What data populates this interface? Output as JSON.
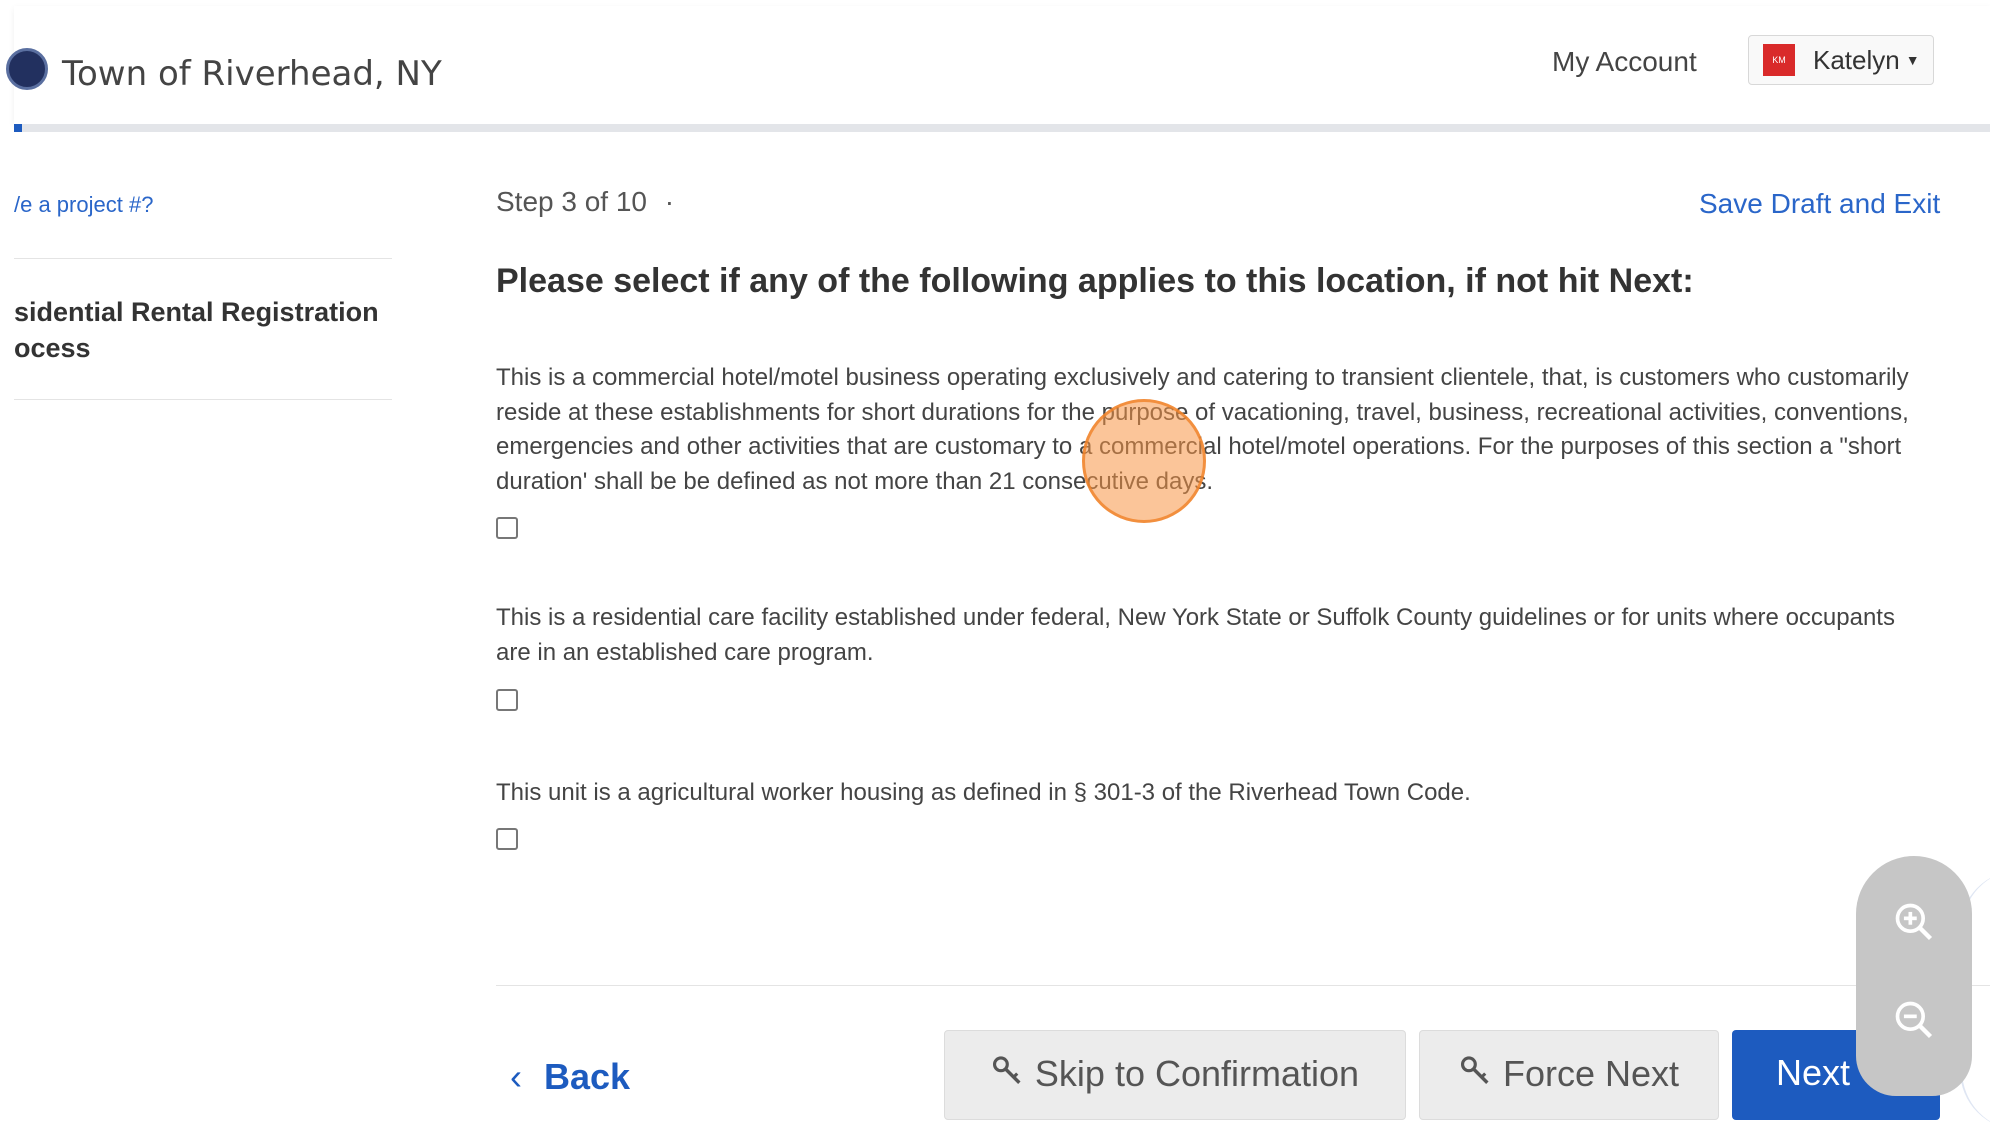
{
  "header": {
    "site_title": "Town of Riverhead, NY",
    "my_account": "My Account",
    "user_name": "Katelyn",
    "user_initials": "KM",
    "progress_fraction": 0.004,
    "accent_color": "#1d5bbf"
  },
  "sidebar": {
    "project_link": "/e a project #?",
    "process_title": "sidential Rental Registration ocess"
  },
  "main": {
    "step": "Step 3 of 10",
    "step_separator": "·",
    "save_draft": "Save Draft and Exit",
    "title": "Please select if any of the following applies to this location, if not hit Next:",
    "options": [
      {
        "text": "This is a commercial hotel/motel business operating exclusively and catering to transient clientele, that, is customers who customarily reside at these establishments for short durations for the purpose of vacationing, travel, business, recreational activities, conventions, emergencies and other activities that are customary to a commercial hotel/motel operations. For the purposes of this section a \"short duration' shall be be defined as not more than 21 consecutive days.",
        "checked": false
      },
      {
        "text": "This is a residential care facility established under federal, New York State or Suffolk County guidelines or for units where occupants are in an established care program.",
        "checked": false
      },
      {
        "text": "This unit is a agricultural worker housing as defined in § 301-3 of the Riverhead Town Code.",
        "checked": false
      }
    ]
  },
  "footer": {
    "back": "Back",
    "skip": "Skip to Confirmation",
    "force_next": "Force Next",
    "next": "Next"
  },
  "icons": {
    "zoom_in": "zoom-in-icon",
    "zoom_out": "zoom-out-icon",
    "key": "key-icon",
    "back": "chevron-left-icon",
    "next": "chevron-right-icon"
  }
}
